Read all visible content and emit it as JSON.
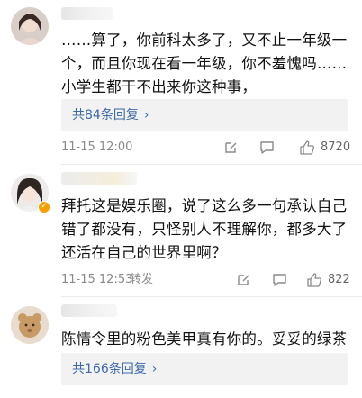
{
  "comments": [
    {
      "text": "……算了，你前科太多了，又不止一年级一个，而且你现在看一年级，你不羞愧吗……小学生都干不出来你这种事，",
      "reply_label": "共84条回复",
      "time": "11-15 12:00",
      "translate": "",
      "likes": "8720",
      "verified": false
    },
    {
      "text": "拜托这是娱乐圈，说了这么多一句承认自己错了都没有，只怪别人不理解你，都多大了还活在自己的世界里啊？",
      "reply_label": "",
      "time": "11-15 12:53",
      "translate": "转发",
      "likes": "822",
      "verified": true
    },
    {
      "text": "陈情令里的粉色美甲真有你的。妥妥的绿茶",
      "reply_label": "共166条回复",
      "time": "",
      "translate": "",
      "likes": "",
      "verified": false
    }
  ],
  "icons": {
    "chevron": "chevron-right-icon",
    "edit": "edit-icon",
    "comment": "comment-icon",
    "like": "thumbs-up-icon"
  }
}
